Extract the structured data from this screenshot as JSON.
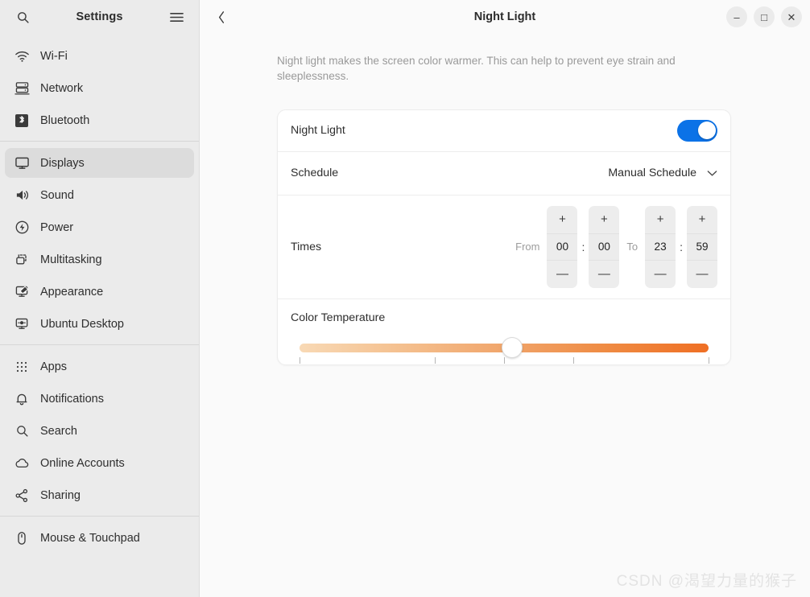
{
  "sidebar": {
    "title": "Settings",
    "search_icon": "search-icon",
    "menu_icon": "hamburger-menu-icon",
    "groups": [
      {
        "items": [
          {
            "label": "Wi-Fi",
            "icon": "wifi-icon",
            "active": false
          },
          {
            "label": "Network",
            "icon": "network-icon",
            "active": false
          },
          {
            "label": "Bluetooth",
            "icon": "bluetooth-icon",
            "active": false
          }
        ]
      },
      {
        "items": [
          {
            "label": "Displays",
            "icon": "display-icon",
            "active": true
          },
          {
            "label": "Sound",
            "icon": "sound-icon",
            "active": false
          },
          {
            "label": "Power",
            "icon": "power-icon",
            "active": false
          },
          {
            "label": "Multitasking",
            "icon": "multitasking-icon",
            "active": false
          },
          {
            "label": "Appearance",
            "icon": "appearance-icon",
            "active": false
          },
          {
            "label": "Ubuntu Desktop",
            "icon": "ubuntu-desktop-icon",
            "active": false
          }
        ]
      },
      {
        "items": [
          {
            "label": "Apps",
            "icon": "apps-grid-icon",
            "active": false
          },
          {
            "label": "Notifications",
            "icon": "bell-icon",
            "active": false
          },
          {
            "label": "Search",
            "icon": "search-icon",
            "active": false
          },
          {
            "label": "Online Accounts",
            "icon": "cloud-icon",
            "active": false
          },
          {
            "label": "Sharing",
            "icon": "share-icon",
            "active": false
          }
        ]
      },
      {
        "items": [
          {
            "label": "Mouse & Touchpad",
            "icon": "mouse-icon",
            "active": false
          }
        ]
      }
    ]
  },
  "titlebar": {
    "title": "Night Light",
    "back_icon": "chevron-left-icon",
    "minimize_label": "–",
    "maximize_label": "□",
    "close_label": "✕"
  },
  "main": {
    "description": "Night light makes the screen color warmer. This can help to prevent eye strain and sleeplessness.",
    "night_light": {
      "label": "Night Light",
      "enabled": true,
      "accent_color": "#0b72e7"
    },
    "schedule": {
      "label": "Schedule",
      "value": "Manual Schedule",
      "chevron_icon": "chevron-down-icon"
    },
    "times": {
      "label": "Times",
      "from_label": "From",
      "to_label": "To",
      "separator": ":",
      "plus_label": "+",
      "minus_label": "—",
      "from_hour": "00",
      "from_minute": "00",
      "to_hour": "23",
      "to_minute": "59"
    },
    "color_temperature": {
      "label": "Color Temperature",
      "value_percent": 52,
      "gradient_start": "#f8d9b5",
      "gradient_end": "#ef6f24",
      "ticks_percent": [
        0,
        33,
        50,
        67,
        100
      ]
    }
  },
  "watermark": "CSDN @渴望力量的猴子"
}
